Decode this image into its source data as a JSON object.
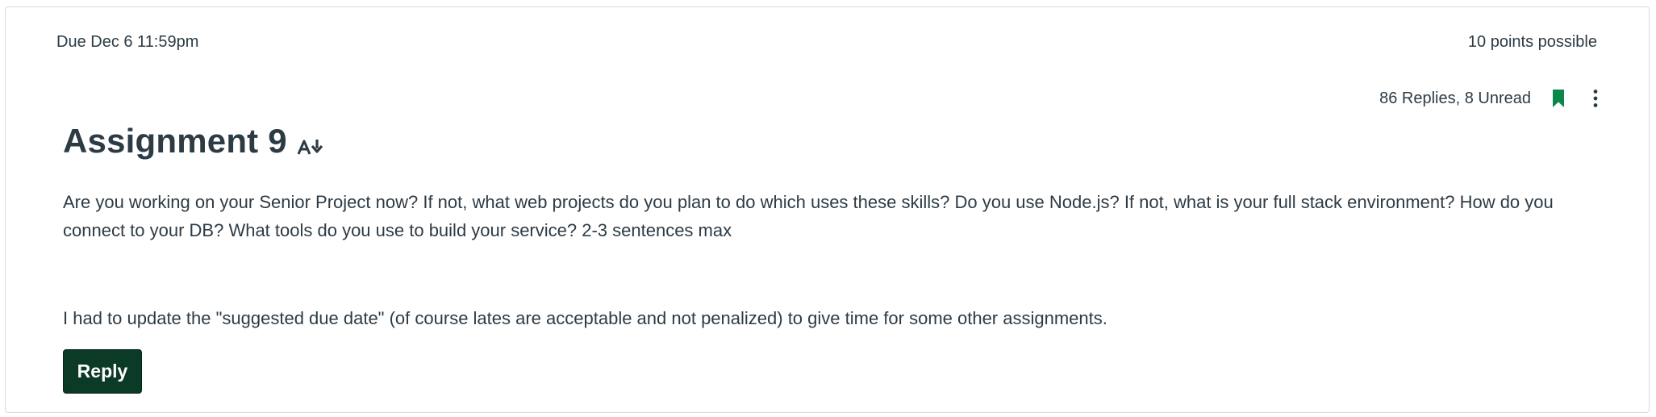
{
  "assignment": {
    "due": "Due Dec 6 11:59pm",
    "points": "10 points possible",
    "replies_status": "86 Replies, 8 Unread",
    "title": "Assignment 9",
    "body_paragraph_1": "Are you working on your Senior Project now?  If not, what web projects do you plan to do which uses these skills?  Do you use Node.js?  If not, what is your full stack environment?  How do you connect to your DB?  What tools do you use to build your service? 2-3 sentences max",
    "body_paragraph_2": "I had to update the \"suggested due date\" (of course lates are acceptable and not penalized) to give time for some other assignments.",
    "reply_label": "Reply"
  },
  "icons": {
    "bookmark": "bookmark-icon",
    "more": "kebab-menu-icon",
    "translate": "translate-icon"
  },
  "colors": {
    "text": "#2d3b45",
    "accent_green": "#0b874b",
    "reply_button_bg": "#0b3a26",
    "border": "#d7dadc"
  }
}
